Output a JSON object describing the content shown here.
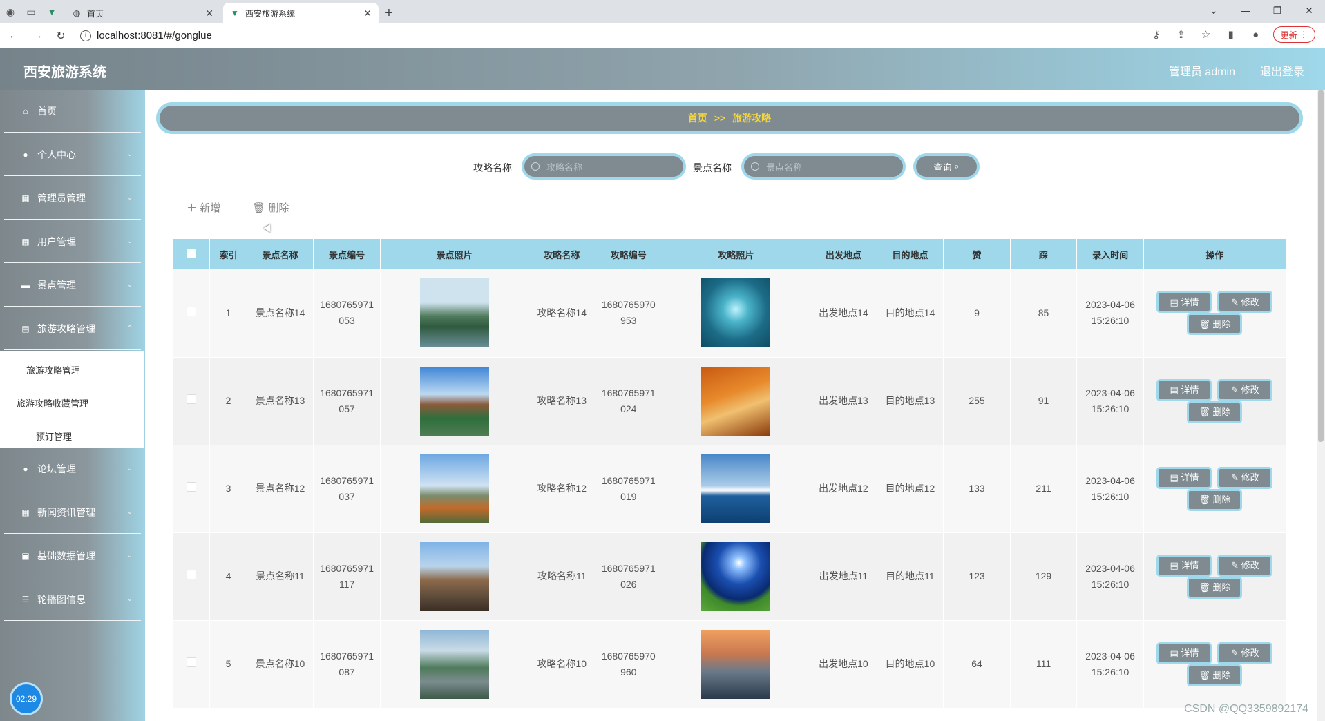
{
  "browser": {
    "tabs": [
      {
        "title": "首页",
        "active": false
      },
      {
        "title": "西安旅游系统",
        "active": true
      }
    ],
    "url": "localhost:8081/#/gonglue",
    "update_label": "更新"
  },
  "header": {
    "title": "西安旅游系统",
    "user": "管理员 admin",
    "logout": "退出登录"
  },
  "sidebar": {
    "items": [
      {
        "label": "首页",
        "icon": "home-icon"
      },
      {
        "label": "个人中心",
        "icon": "user-icon"
      },
      {
        "label": "管理员管理",
        "icon": "grid-icon"
      },
      {
        "label": "用户管理",
        "icon": "grid-icon"
      },
      {
        "label": "景点管理",
        "icon": "chat-icon"
      },
      {
        "label": "旅游攻略管理",
        "icon": "lock-icon"
      },
      {
        "label": "论坛管理",
        "icon": "user-icon"
      },
      {
        "label": "新闻资讯管理",
        "icon": "grid-icon"
      },
      {
        "label": "基础数据管理",
        "icon": "box-icon"
      },
      {
        "label": "轮播图信息",
        "icon": "list-icon"
      }
    ],
    "submenu": [
      "旅游攻略管理",
      "旅游攻略收藏管理",
      "预订管理"
    ],
    "clock": "02:29"
  },
  "breadcrumb": {
    "home": "首页",
    "sep": ">>",
    "current": "旅游攻略"
  },
  "search": {
    "label1": "攻略名称",
    "placeholder1": "攻略名称",
    "label2": "景点名称",
    "placeholder2": "景点名称",
    "button": "查询"
  },
  "actions": {
    "add": "新增",
    "delete": "删除"
  },
  "table": {
    "headers": [
      "索引",
      "景点名称",
      "景点编号",
      "景点照片",
      "攻略名称",
      "攻略编号",
      "攻略照片",
      "出发地点",
      "目的地点",
      "赞",
      "踩",
      "录入时间",
      "操作"
    ],
    "ops": [
      "详情",
      "修改",
      "删除"
    ],
    "rows": [
      {
        "idx": "1",
        "spot_name": "景点名称14",
        "spot_no": "1680765971053",
        "guide_name": "攻略名称14",
        "guide_no": "1680765970953",
        "from": "出发地点14",
        "to": "目的地点14",
        "like": "9",
        "dislike": "85",
        "time": "2023-04-06 15:26:10"
      },
      {
        "idx": "2",
        "spot_name": "景点名称13",
        "spot_no": "1680765971057",
        "guide_name": "攻略名称13",
        "guide_no": "1680765971024",
        "from": "出发地点13",
        "to": "目的地点13",
        "like": "255",
        "dislike": "91",
        "time": "2023-04-06 15:26:10"
      },
      {
        "idx": "3",
        "spot_name": "景点名称12",
        "spot_no": "1680765971037",
        "guide_name": "攻略名称12",
        "guide_no": "1680765971019",
        "from": "出发地点12",
        "to": "目的地点12",
        "like": "133",
        "dislike": "211",
        "time": "2023-04-06 15:26:10"
      },
      {
        "idx": "4",
        "spot_name": "景点名称11",
        "spot_no": "1680765971117",
        "guide_name": "攻略名称11",
        "guide_no": "1680765971026",
        "from": "出发地点11",
        "to": "目的地点11",
        "like": "123",
        "dislike": "129",
        "time": "2023-04-06 15:26:10"
      },
      {
        "idx": "5",
        "spot_name": "景点名称10",
        "spot_no": "1680765971087",
        "guide_name": "攻略名称10",
        "guide_no": "1680765970960",
        "from": "出发地点10",
        "to": "目的地点10",
        "like": "64",
        "dislike": "111",
        "time": "2023-04-06 15:26:10"
      }
    ]
  },
  "watermark": "CSDN @QQ3359892174"
}
